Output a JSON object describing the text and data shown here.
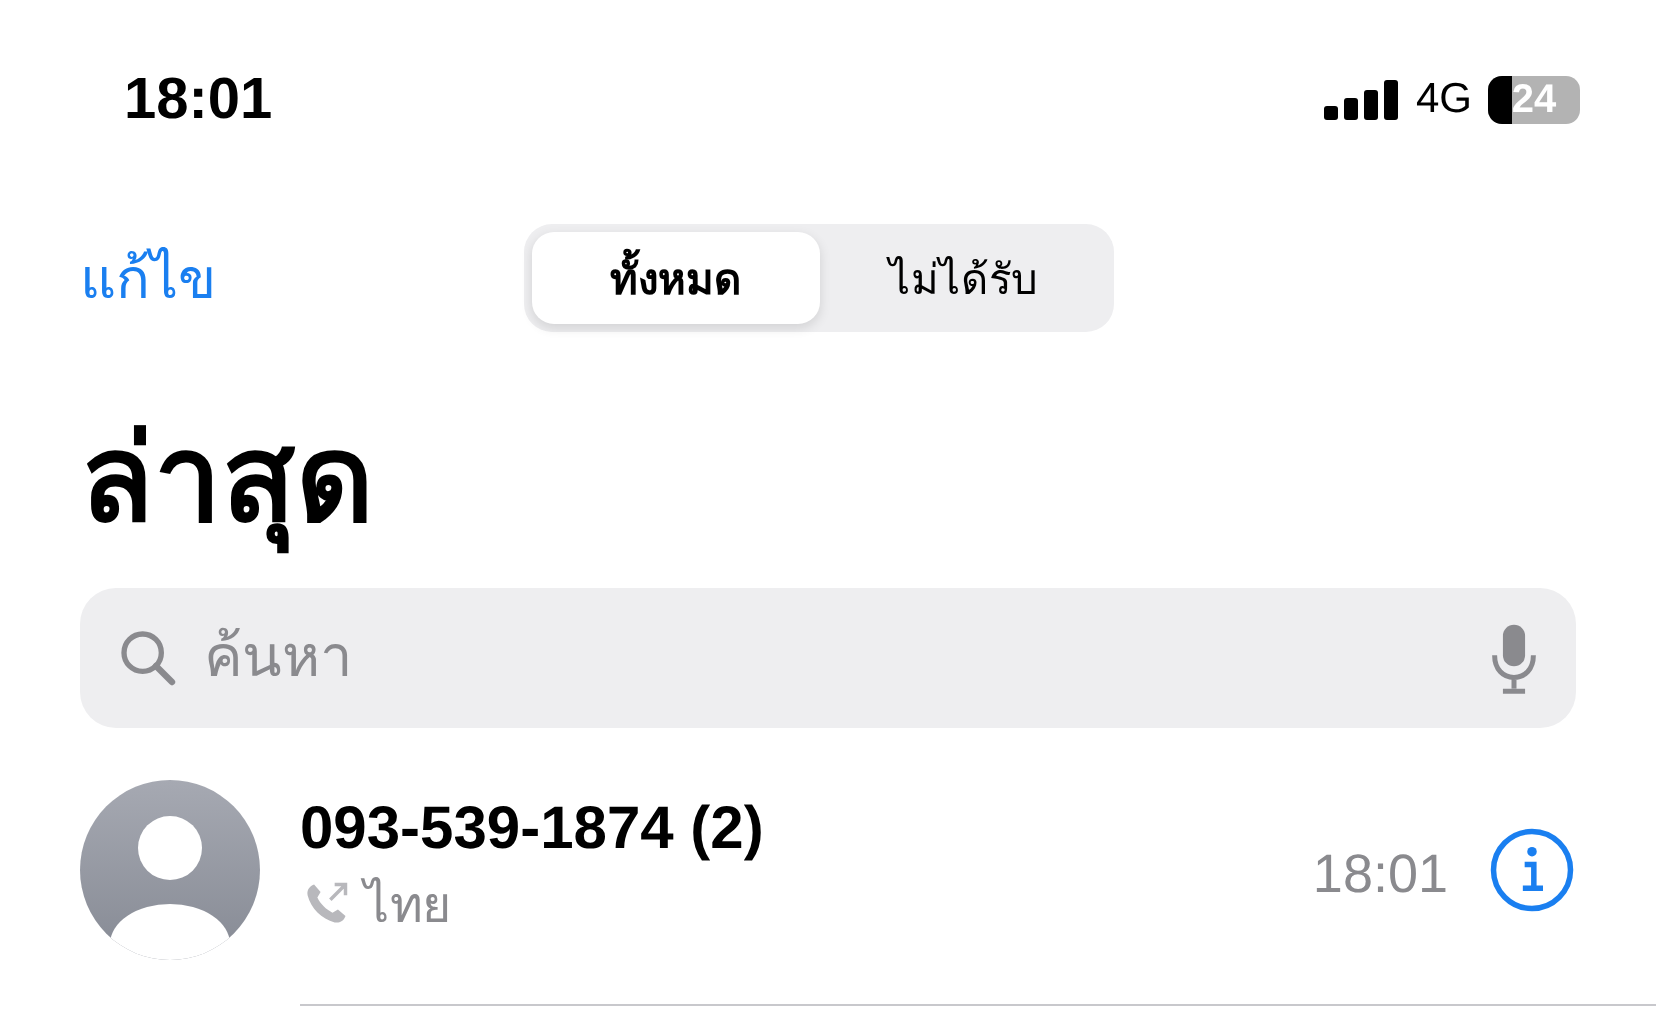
{
  "status_bar": {
    "time": "18:01",
    "network": "4G",
    "battery": "24"
  },
  "nav": {
    "edit": "แก้ไข",
    "segments": [
      {
        "label": "ทั้งหมด",
        "selected": true
      },
      {
        "label": "ไม่ได้รับ",
        "selected": false
      }
    ]
  },
  "title": "ล่าสุด",
  "search": {
    "placeholder": "ค้นหา"
  },
  "calls": [
    {
      "number": "093-539-1874 (2)",
      "kind": "outgoing",
      "label": "ไทย",
      "time": "18:01"
    }
  ]
}
